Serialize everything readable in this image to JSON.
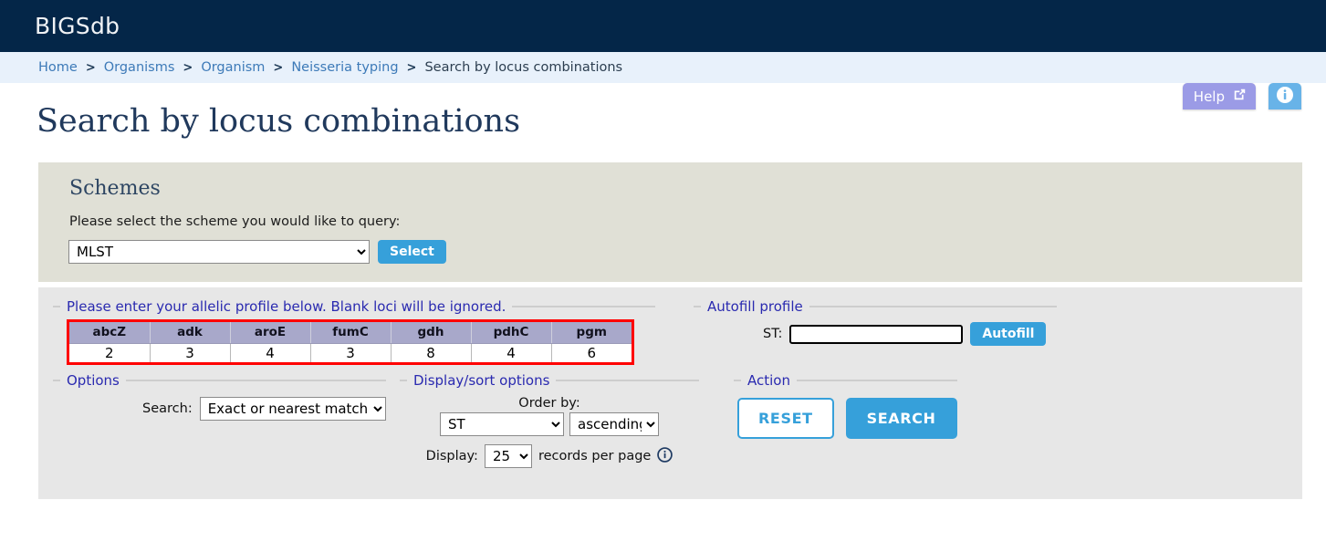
{
  "header": {
    "app_title": "BIGSdb"
  },
  "breadcrumb": {
    "items": [
      {
        "label": "Home",
        "current": false
      },
      {
        "label": "Organisms",
        "current": false
      },
      {
        "label": "Organism",
        "current": false
      },
      {
        "label": "Neisseria typing",
        "current": false
      },
      {
        "label": "Search by locus combinations",
        "current": true
      }
    ],
    "separator": ">"
  },
  "utility": {
    "help_label": "Help",
    "help_icon": "external-link-icon",
    "info_icon": "info-icon",
    "help_color": "#9b9be6",
    "info_color": "#68b3e8"
  },
  "page": {
    "title": "Search by locus combinations"
  },
  "schemes": {
    "heading": "Schemes",
    "prompt": "Please select the scheme you would like to query:",
    "selected_scheme": "MLST",
    "select_button": "Select"
  },
  "profile": {
    "legend": "Please enter your allelic profile below. Blank loci will be ignored.",
    "loci": [
      "abcZ",
      "adk",
      "aroE",
      "fumC",
      "gdh",
      "pdhC",
      "pgm"
    ],
    "values": [
      "2",
      "3",
      "4",
      "3",
      "8",
      "4",
      "6"
    ],
    "highlight_color": "#ff0000",
    "header_color": "#a8a8ca"
  },
  "autofill": {
    "legend": "Autofill profile",
    "st_label": "ST:",
    "st_value": "",
    "st_placeholder": "",
    "button": "Autofill"
  },
  "options": {
    "legend": "Options",
    "search_label": "Search:",
    "search_mode": "Exact or nearest match"
  },
  "display": {
    "legend": "Display/sort options",
    "order_by_label": "Order by:",
    "order_by_field": "ST",
    "order_direction": "ascending",
    "display_label": "Display:",
    "records_per_page": "25",
    "records_suffix": "records per page",
    "info_icon": "info-circle-icon"
  },
  "action": {
    "legend": "Action",
    "reset_label": "RESET",
    "search_label": "SEARCH",
    "accent_color": "#36a0da"
  }
}
